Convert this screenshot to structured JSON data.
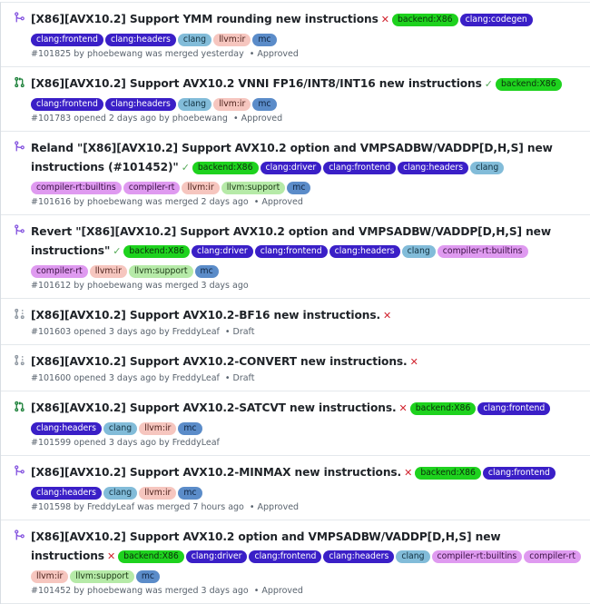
{
  "label_colors": {
    "backend:X86": {
      "bg": "#1ed21e",
      "fg": "#0b2e0b"
    },
    "clang:codegen": {
      "bg": "#3a1fc7",
      "fg": "#ffffff"
    },
    "clang:frontend": {
      "bg": "#3a1fc7",
      "fg": "#ffffff"
    },
    "clang:headers": {
      "bg": "#3a1fc7",
      "fg": "#ffffff"
    },
    "clang:driver": {
      "bg": "#3a1fc7",
      "fg": "#ffffff"
    },
    "clang": {
      "bg": "#82bcd9",
      "fg": "#10303f"
    },
    "llvm:ir": {
      "bg": "#f6c6bf",
      "fg": "#4a1f19"
    },
    "mc": {
      "bg": "#5b8cc9",
      "fg": "#0d2340"
    },
    "compiler-rt:builtins": {
      "bg": "#df9af0",
      "fg": "#3a1044"
    },
    "compiler-rt": {
      "bg": "#df9af0",
      "fg": "#3a1044"
    },
    "llvm:support": {
      "bg": "#b6eaa8",
      "fg": "#1d3a16"
    }
  },
  "status_colors": {
    "merged": "#8250df",
    "open": "#1a7f37",
    "draft": "#8c959f"
  },
  "pull_requests": [
    {
      "state": "merged",
      "icon": "git-merge-icon",
      "title": "[X86][AVX10.2] Support YMM rounding new instructions",
      "check": "fail",
      "check_glyph": "✕",
      "labels": [
        "backend:X86",
        "clang:codegen",
        "clang:frontend",
        "clang:headers",
        "clang",
        "llvm:ir",
        "mc"
      ],
      "number": "#101825",
      "meta_text": "by phoebewang was merged yesterday",
      "review": "Approved"
    },
    {
      "state": "open",
      "icon": "git-pull-request-icon",
      "title": "[X86][AVX10.2] Support AVX10.2 VNNI FP16/INT8/INT16 new instructions",
      "check": "ok",
      "check_glyph": "✓",
      "labels": [
        "backend:X86",
        "clang:frontend",
        "clang:headers",
        "clang",
        "llvm:ir",
        "mc"
      ],
      "number": "#101783",
      "meta_text": "opened 2 days ago by phoebewang",
      "review": "Approved"
    },
    {
      "state": "merged",
      "icon": "git-merge-icon",
      "title": "Reland \"[X86][AVX10.2] Support AVX10.2 option and VMPSADBW/VADDP[D,H,S] new instructions (#101452)\"",
      "check": "ok",
      "check_glyph": "✓",
      "labels": [
        "backend:X86",
        "clang:driver",
        "clang:frontend",
        "clang:headers",
        "clang",
        "compiler-rt:builtins",
        "compiler-rt",
        "llvm:ir",
        "llvm:support",
        "mc"
      ],
      "number": "#101616",
      "meta_text": "by phoebewang was merged 2 days ago",
      "review": "Approved"
    },
    {
      "state": "merged",
      "icon": "git-merge-icon",
      "title": "Revert \"[X86][AVX10.2] Support AVX10.2 option and VMPSADBW/VADDP[D,H,S] new instructions\"",
      "check": "ok",
      "check_glyph": "✓",
      "labels": [
        "backend:X86",
        "clang:driver",
        "clang:frontend",
        "clang:headers",
        "clang",
        "compiler-rt:builtins",
        "compiler-rt",
        "llvm:ir",
        "llvm:support",
        "mc"
      ],
      "number": "#101612",
      "meta_text": "by phoebewang was merged 3 days ago",
      "review": ""
    },
    {
      "state": "draft",
      "icon": "git-pull-request-draft-icon",
      "title": "[X86][AVX10.2] Support AVX10.2-BF16 new instructions.",
      "check": "fail",
      "check_glyph": "✕",
      "labels": [],
      "number": "#101603",
      "meta_text": "opened 3 days ago by FreddyLeaf",
      "review": "Draft"
    },
    {
      "state": "draft",
      "icon": "git-pull-request-draft-icon",
      "title": "[X86][AVX10.2] Support AVX10.2-CONVERT new instructions.",
      "check": "fail",
      "check_glyph": "✕",
      "labels": [],
      "number": "#101600",
      "meta_text": "opened 3 days ago by FreddyLeaf",
      "review": "Draft"
    },
    {
      "state": "open",
      "icon": "git-pull-request-icon",
      "title": "[X86][AVX10.2] Support AVX10.2-SATCVT new instructions.",
      "check": "fail",
      "check_glyph": "✕",
      "labels": [
        "backend:X86",
        "clang:frontend",
        "clang:headers",
        "clang",
        "llvm:ir",
        "mc"
      ],
      "number": "#101599",
      "meta_text": "opened 3 days ago by FreddyLeaf",
      "review": ""
    },
    {
      "state": "merged",
      "icon": "git-merge-icon",
      "title": "[X86][AVX10.2] Support AVX10.2-MINMAX new instructions.",
      "check": "fail",
      "check_glyph": "✕",
      "labels": [
        "backend:X86",
        "clang:frontend",
        "clang:headers",
        "clang",
        "llvm:ir",
        "mc"
      ],
      "number": "#101598",
      "meta_text": "by FreddyLeaf was merged 7 hours ago",
      "review": "Approved"
    },
    {
      "state": "merged",
      "icon": "git-merge-icon",
      "title": "[X86][AVX10.2] Support AVX10.2 option and VMPSADBW/VADDP[D,H,S] new instructions",
      "check": "fail",
      "check_glyph": "✕",
      "labels": [
        "backend:X86",
        "clang:driver",
        "clang:frontend",
        "clang:headers",
        "clang",
        "compiler-rt:builtins",
        "compiler-rt",
        "llvm:ir",
        "llvm:support",
        "mc"
      ],
      "number": "#101452",
      "meta_text": "by phoebewang was merged 3 days ago",
      "review": "Approved"
    }
  ]
}
